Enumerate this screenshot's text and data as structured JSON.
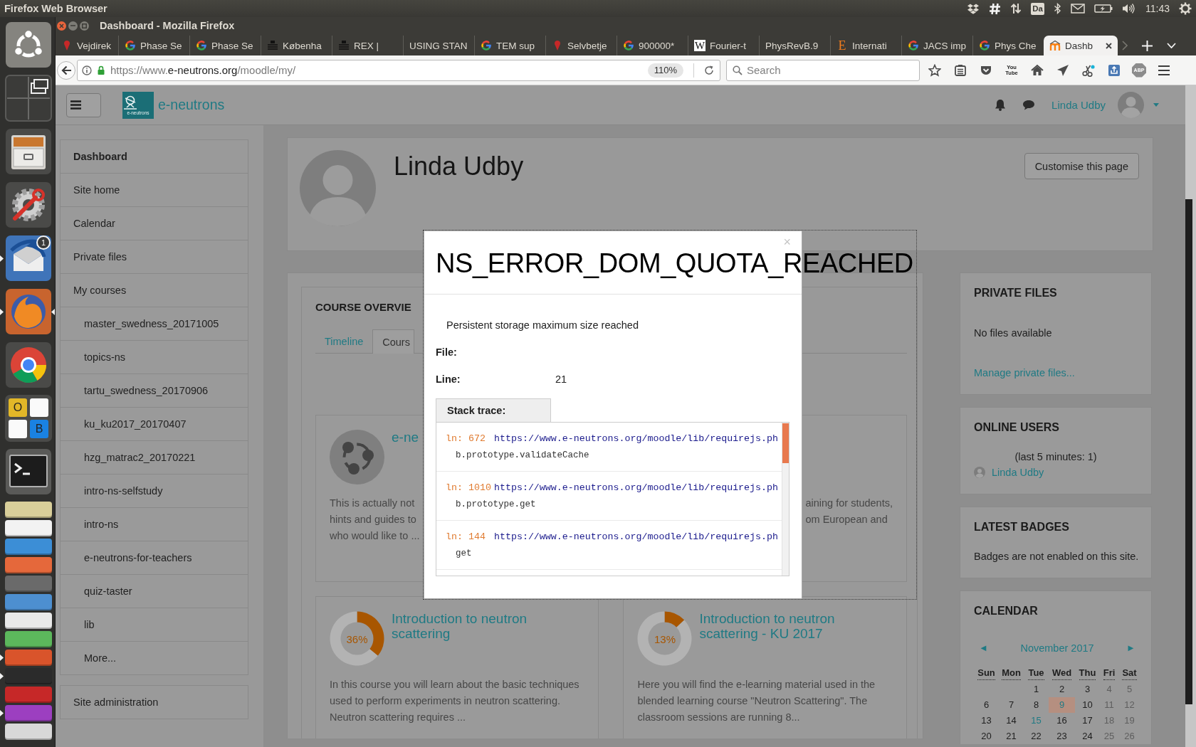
{
  "system_panel": {
    "app_name": "Firefox Web Browser",
    "keyboard_layout": "Da",
    "clock": "11:43"
  },
  "launcher": {
    "items": [
      {
        "kind": "ubuntu",
        "running": false,
        "focused": false
      },
      {
        "kind": "workspaces",
        "running": false,
        "focused": false
      },
      {
        "kind": "files",
        "running": false,
        "focused": false
      },
      {
        "kind": "settings",
        "running": false,
        "focused": false
      },
      {
        "kind": "mail",
        "running": true,
        "focused": false,
        "badge": "1"
      },
      {
        "kind": "firefox",
        "running": true,
        "focused": true
      },
      {
        "kind": "chrome",
        "running": false,
        "focused": false
      },
      {
        "kind": "tiles",
        "running": false,
        "focused": false,
        "letters": [
          "O",
          "B"
        ]
      },
      {
        "kind": "terminal",
        "running": false,
        "focused": false
      },
      {
        "kind": "folded",
        "color": "#d9cf9a",
        "running": false,
        "focused": false
      },
      {
        "kind": "folded",
        "color": "#f2f2f2",
        "running": false,
        "focused": false
      },
      {
        "kind": "folded",
        "color": "#3c8ed6",
        "running": false,
        "focused": false
      },
      {
        "kind": "folded",
        "color": "#e5683b",
        "running": false,
        "focused": false
      },
      {
        "kind": "folded",
        "color": "#6a6a6a",
        "running": false,
        "focused": false
      },
      {
        "kind": "folded",
        "color": "#4d8fd0",
        "running": false,
        "focused": false
      },
      {
        "kind": "folded",
        "color": "#e9e9e9",
        "running": false,
        "focused": false
      },
      {
        "kind": "folded",
        "color": "#5cb85c",
        "running": false,
        "focused": false
      },
      {
        "kind": "folded",
        "color": "#d9542b",
        "running": true,
        "focused": false
      },
      {
        "kind": "folded",
        "color": "#2b2b2b",
        "running": true,
        "focused": false
      },
      {
        "kind": "folded",
        "color": "#c62828",
        "running": false,
        "focused": false
      },
      {
        "kind": "folded",
        "color": "#9c3fc0",
        "running": true,
        "focused": false
      },
      {
        "kind": "folded",
        "color": "#d8d8d8",
        "running": false,
        "focused": false
      }
    ]
  },
  "window": {
    "title": "Dashboard - Mozilla Firefox"
  },
  "tabs": [
    {
      "label": "Vejdirek",
      "kind": "pin",
      "selected": false
    },
    {
      "label": "Phase Se",
      "kind": "google",
      "selected": false
    },
    {
      "label": "Phase Se",
      "kind": "google",
      "selected": false
    },
    {
      "label": "Københa",
      "kind": "lines",
      "selected": false
    },
    {
      "label": "REX |",
      "kind": "lines",
      "selected": false
    },
    {
      "label": "USING STAN",
      "kind": "none",
      "selected": false
    },
    {
      "label": "TEM sup",
      "kind": "google",
      "selected": false
    },
    {
      "label": "Selvbetje",
      "kind": "pin",
      "selected": false
    },
    {
      "label": "900000*",
      "kind": "google",
      "selected": false
    },
    {
      "label": "Fourier-t",
      "kind": "boxed-letter",
      "icon_text": "W",
      "selected": false
    },
    {
      "label": "PhysRevB.9",
      "kind": "none",
      "selected": false
    },
    {
      "label": "Internati",
      "kind": "letter",
      "icon_text": "E",
      "selected": false
    },
    {
      "label": "JACS imp",
      "kind": "google",
      "selected": false
    },
    {
      "label": "Phys Che",
      "kind": "google",
      "selected": false
    },
    {
      "label": "Dashb",
      "kind": "arches",
      "selected": true
    }
  ],
  "toolbar": {
    "url": {
      "prefix": "https://www.",
      "domain": "e-neutrons.org",
      "path": "/moodle/my/"
    },
    "zoom": "110%",
    "search": {
      "placeholder": "Search"
    },
    "buttons": [
      {
        "kind": "star"
      },
      {
        "kind": "reading-list"
      },
      {
        "kind": "pocket"
      },
      {
        "kind": "video",
        "label": "You Tube"
      },
      {
        "kind": "home"
      },
      {
        "kind": "send"
      },
      {
        "kind": "scissors"
      },
      {
        "kind": "upload"
      },
      {
        "kind": "adblock",
        "label": "ABP"
      },
      {
        "kind": "menu"
      }
    ]
  },
  "site_header": {
    "logo_caption": "e-neutrons",
    "site_name": "e-neutrons",
    "user_name": "Linda Udby"
  },
  "sidebar": {
    "items": [
      {
        "label": "Dashboard",
        "selected": true
      },
      {
        "label": "Site home",
        "selected": false
      },
      {
        "label": "Calendar",
        "selected": false
      },
      {
        "label": "Private files",
        "selected": false
      },
      {
        "label": "My courses",
        "selected": false,
        "children": [
          {
            "label": "master_swedness_20171005",
            "selected": false
          },
          {
            "label": "topics-ns",
            "selected": false
          },
          {
            "label": "tartu_swedness_20170906",
            "selected": false
          },
          {
            "label": "ku_ku2017_20170407",
            "selected": false
          },
          {
            "label": "hzg_matrac2_20170221",
            "selected": false
          },
          {
            "label": "intro-ns-selfstudy",
            "selected": false
          },
          {
            "label": "intro-ns",
            "selected": false
          },
          {
            "label": "e-neutrons-for-teachers",
            "selected": false
          },
          {
            "label": "quiz-taster",
            "selected": false
          },
          {
            "label": "lib",
            "selected": false
          },
          {
            "label": "More...",
            "selected": false
          }
        ]
      }
    ]
  },
  "admin": {
    "items": [
      {
        "label": "Site administration",
        "selected": false
      }
    ]
  },
  "profile": {
    "name": "Linda Udby",
    "button": "Customise this page"
  },
  "course_overview": {
    "title": "COURSE OVERVIE",
    "tabs": [
      {
        "label": "Timeline",
        "selected": false
      },
      {
        "label": "Cours",
        "selected": true
      }
    ],
    "courses": [
      {
        "kind": "icon",
        "title": "e-ne",
        "description": "This is actually not\nhints and guides to\nwho would like to ..."
      },
      {
        "kind": "covered",
        "description": "aining for students,\nom European and"
      },
      {
        "kind": "progress",
        "chart_data": {
          "type": "donut",
          "values": [
            36,
            64
          ]
        },
        "reading": "36%",
        "title": "Introduction to neutron scattering",
        "description": "In this course you will learn about the basic techniques used to perform experiments in neutron scattering. Neutron scattering requires ..."
      },
      {
        "kind": "progress",
        "chart_data": {
          "type": "donut",
          "values": [
            13,
            87
          ]
        },
        "reading": "13%",
        "title": "Introduction to neutron scattering - KU 2017",
        "description": "Here you will find the e-learning material used in the blended learning course \"Neutron Scattering\". The classroom sessions are running 8..."
      }
    ]
  },
  "blocks": [
    {
      "kind": "files",
      "title": "PRIVATE FILES",
      "text": "No files available",
      "link": "Manage private files..."
    },
    {
      "kind": "users",
      "title": "ONLINE USERS",
      "text": "(last 5 minutes: 1)",
      "users": [
        "Linda Udby"
      ]
    },
    {
      "kind": "badges",
      "title": "LATEST BADGES",
      "text": "Badges are not enabled on this site."
    },
    {
      "kind": "calendar",
      "title": "CALENDAR",
      "prev": "◄",
      "month": "November 2017",
      "next": "►",
      "weekdays": [
        "Sun",
        "Mon",
        "Tue",
        "Wed",
        "Thu",
        "Fri",
        "Sat"
      ],
      "weeks": [
        [
          {
            "day": "1",
            "kind": "weekday"
          },
          {
            "day": "2",
            "kind": "weekday"
          },
          {
            "day": "3",
            "kind": "weekday"
          },
          {
            "day": "4",
            "kind": "weekend"
          },
          {
            "day": "5",
            "kind": "weekend"
          }
        ],
        [
          {
            "day": "6",
            "kind": "weekday"
          },
          {
            "day": "7",
            "kind": "weekday"
          },
          {
            "day": "8",
            "kind": "weekday"
          },
          {
            "day": "9",
            "kind": "today"
          },
          {
            "day": "10",
            "kind": "weekday"
          },
          {
            "day": "11",
            "kind": "weekend"
          },
          {
            "day": "12",
            "kind": "weekend"
          }
        ],
        [
          {
            "day": "13",
            "kind": "weekday"
          },
          {
            "day": "14",
            "kind": "weekday"
          },
          {
            "day": "15",
            "kind": "event"
          },
          {
            "day": "16",
            "kind": "weekday"
          },
          {
            "day": "17",
            "kind": "weekday"
          },
          {
            "day": "18",
            "kind": "weekend"
          },
          {
            "day": "19",
            "kind": "weekend"
          }
        ],
        [
          {
            "day": "20",
            "kind": "weekday"
          },
          {
            "day": "21",
            "kind": "weekday"
          },
          {
            "day": "22",
            "kind": "weekday"
          },
          {
            "day": "23",
            "kind": "weekday"
          },
          {
            "day": "24",
            "kind": "weekday"
          },
          {
            "day": "25",
            "kind": "weekend"
          },
          {
            "day": "26",
            "kind": "weekend"
          }
        ]
      ]
    }
  ],
  "error_dialog": {
    "title": "NS_ERROR_DOM_QUOTA_REACHED",
    "close": "×",
    "message": "Persistent storage maximum size reached",
    "fields": [
      {
        "label": "File:"
      },
      {
        "label": "Line:",
        "value": "21"
      }
    ],
    "stack_tab": "Stack trace:",
    "stack": [
      {
        "label": "ln:",
        "line": "672",
        "url": "https://www.e-neutrons.org/moodle/lib/requirejs.ph",
        "function": "b.prototype.validateCache"
      },
      {
        "label": "ln:",
        "line": "1010",
        "url": "https://www.e-neutrons.org/moodle/lib/requirejs.ph",
        "function": "b.prototype.get"
      },
      {
        "label": "ln:",
        "line": "144",
        "url": "https://www.e-neutrons.org/moodle/lib/requirejs.ph",
        "function": "get"
      }
    ]
  }
}
